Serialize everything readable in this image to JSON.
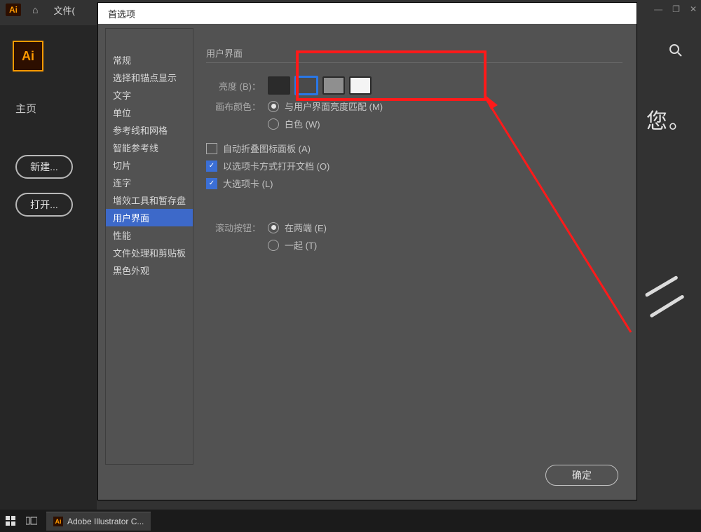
{
  "app": {
    "logo_text": "Ai",
    "menu_file": "文件(",
    "left_logo": "Ai",
    "left_home": "主页",
    "btn_new": "新建...",
    "btn_open": "打开...",
    "right_text": "您。"
  },
  "win_ctrl": {
    "min": "—",
    "max": "❐",
    "close": "✕"
  },
  "dialog": {
    "title": "首选项",
    "side": [
      "常规",
      "选择和锚点显示",
      "文字",
      "单位",
      "参考线和网格",
      "智能参考线",
      "切片",
      "连字",
      "增效工具和暂存盘",
      "用户界面",
      "性能",
      "文件处理和剪贴板",
      "黑色外观"
    ],
    "side_selected": 9,
    "section": "用户界面",
    "brightness_label": "亮度 (B)：",
    "swatches": [
      "#2b2b2b",
      "#4a4a4a",
      "#8f8f8f",
      "#f4f4f4"
    ],
    "swatch_selected": 1,
    "canvas_color_label": "画布颜色：",
    "canvas_opt1": "与用户界面亮度匹配 (M)",
    "canvas_opt2": "白色 (W)",
    "chk_autocollapse": "自动折叠图标面板 (A)",
    "chk_tabs": "以选项卡方式打开文档 (O)",
    "chk_large": "大选项卡 (L)",
    "scroll_label": "滚动按钮：",
    "scroll_opt1": "在两端 (E)",
    "scroll_opt2": "一起 (T)",
    "ok": "确定"
  },
  "taskbar": {
    "app_label": "Adobe Illustrator C..."
  }
}
